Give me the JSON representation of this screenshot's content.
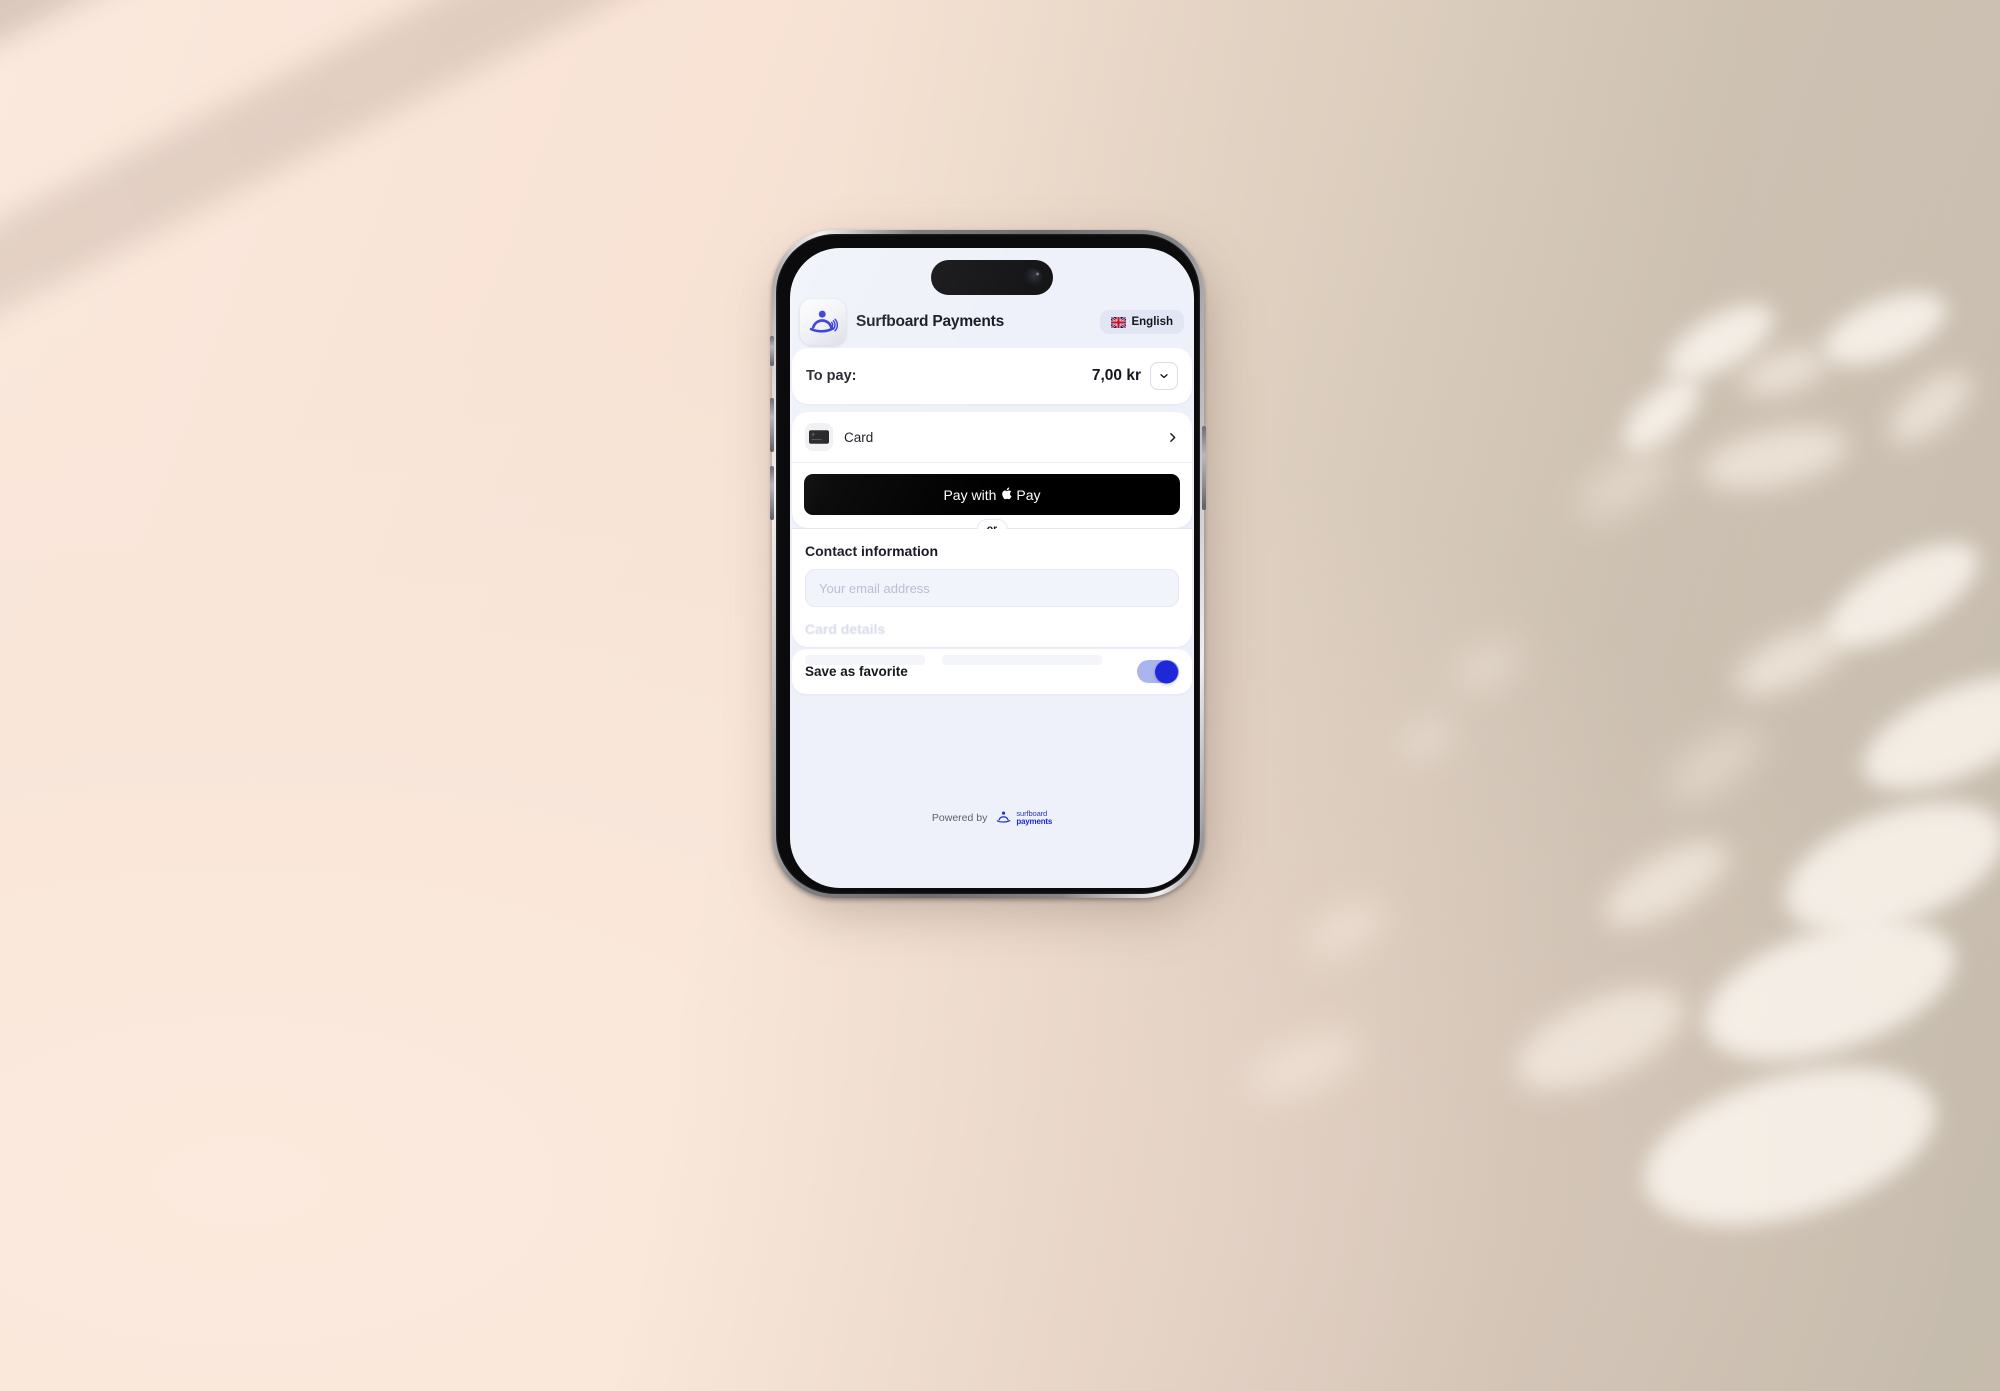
{
  "scene": {
    "background_color": "#f8e6da",
    "shadow_color": "#968276"
  },
  "device": {
    "name": "iPhone",
    "screen_background": "#eef1f9"
  },
  "header": {
    "app_title": "Surfboard Payments",
    "logo_icon": "surfboard-payments-logo",
    "language": {
      "label": "English",
      "flag_icon": "uk-flag-icon"
    }
  },
  "to_pay": {
    "label": "To pay:",
    "amount": "7,00 kr",
    "expand_icon": "chevron-down-icon"
  },
  "payment_method": {
    "label": "Card",
    "icon": "credit-card-icon",
    "chevron_icon": "chevron-right-icon"
  },
  "apple_pay": {
    "prefix": "Pay with",
    "apple_glyph": "",
    "suffix": "Pay"
  },
  "divider": {
    "label": "or"
  },
  "contact": {
    "title": "Contact information",
    "email_placeholder": "Your email address",
    "email_value": ""
  },
  "card_details": {
    "title": "Card details"
  },
  "favorite": {
    "label": "Save as favorite",
    "toggle_state": "on",
    "toggle_on_color": "#1f28d8",
    "toggle_track_color": "#aab4ee"
  },
  "footer": {
    "powered_by": "Powered by",
    "brand_top": "surfboard",
    "brand_bottom": "payments",
    "brand_color": "#1f28d8"
  }
}
